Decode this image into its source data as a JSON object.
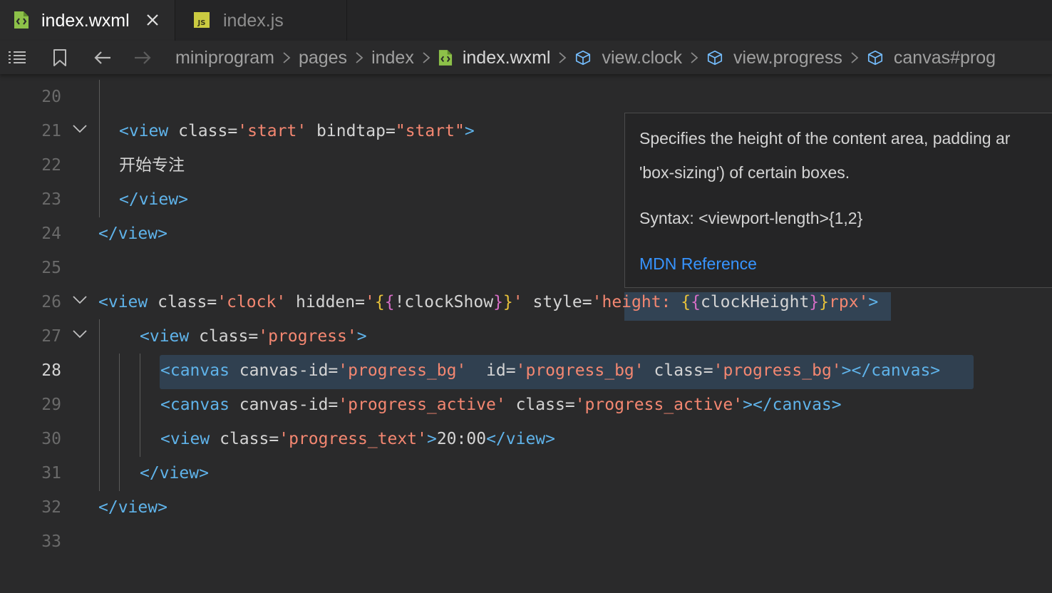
{
  "tabs": [
    {
      "label": "index.wxml",
      "active": true,
      "icon": "wxml-file-icon",
      "closable": true
    },
    {
      "label": "index.js",
      "active": false,
      "icon": "js-file-icon"
    }
  ],
  "breadcrumb": {
    "items": [
      {
        "label": "miniprogram",
        "icon": null
      },
      {
        "label": "pages",
        "icon": null
      },
      {
        "label": "index",
        "icon": null
      },
      {
        "label": "index.wxml",
        "icon": "wxml-file-icon"
      },
      {
        "label": "view.clock",
        "icon": "cube-icon"
      },
      {
        "label": "view.progress",
        "icon": "cube-icon"
      },
      {
        "label": "canvas#prog",
        "icon": "cube-icon"
      }
    ]
  },
  "editor": {
    "active_line": 28,
    "lines": [
      {
        "n": "20",
        "text": ""
      },
      {
        "n": "21",
        "text": "<view class='start' bindtap=\"start\">"
      },
      {
        "n": "22",
        "text": "开始专注"
      },
      {
        "n": "23",
        "text": "</view>"
      },
      {
        "n": "24",
        "text": "</view>"
      },
      {
        "n": "25",
        "text": ""
      },
      {
        "n": "26",
        "text": "<view class='clock' hidden='{{!clockShow}}' style='height: {{clockHeight}}rpx'>"
      },
      {
        "n": "27",
        "text": "<view class='progress'>"
      },
      {
        "n": "28",
        "text": "<canvas canvas-id='progress_bg'  id='progress_bg' class='progress_bg'></canvas>"
      },
      {
        "n": "29",
        "text": "<canvas canvas-id='progress_active' class='progress_active'></canvas>"
      },
      {
        "n": "30",
        "text": "<view class='progress_text'>20:00</view>"
      },
      {
        "n": "31",
        "text": "</view>"
      },
      {
        "n": "32",
        "text": "</view>"
      },
      {
        "n": "33",
        "text": ""
      }
    ]
  },
  "hover": {
    "line1": "Specifies the height of the content area, padding ar",
    "line2": "'box-sizing') of certain boxes.",
    "syntax": "Syntax: <viewport-length>{1,2}",
    "link": "MDN Reference"
  },
  "colors": {
    "background": "#2a2a2b",
    "tag": "#5fb3ea",
    "string": "#f48771",
    "brace": "#e8c23a",
    "link": "#3794ff",
    "wxml_icon": "#8dc149",
    "js_icon": "#cbcb41"
  }
}
